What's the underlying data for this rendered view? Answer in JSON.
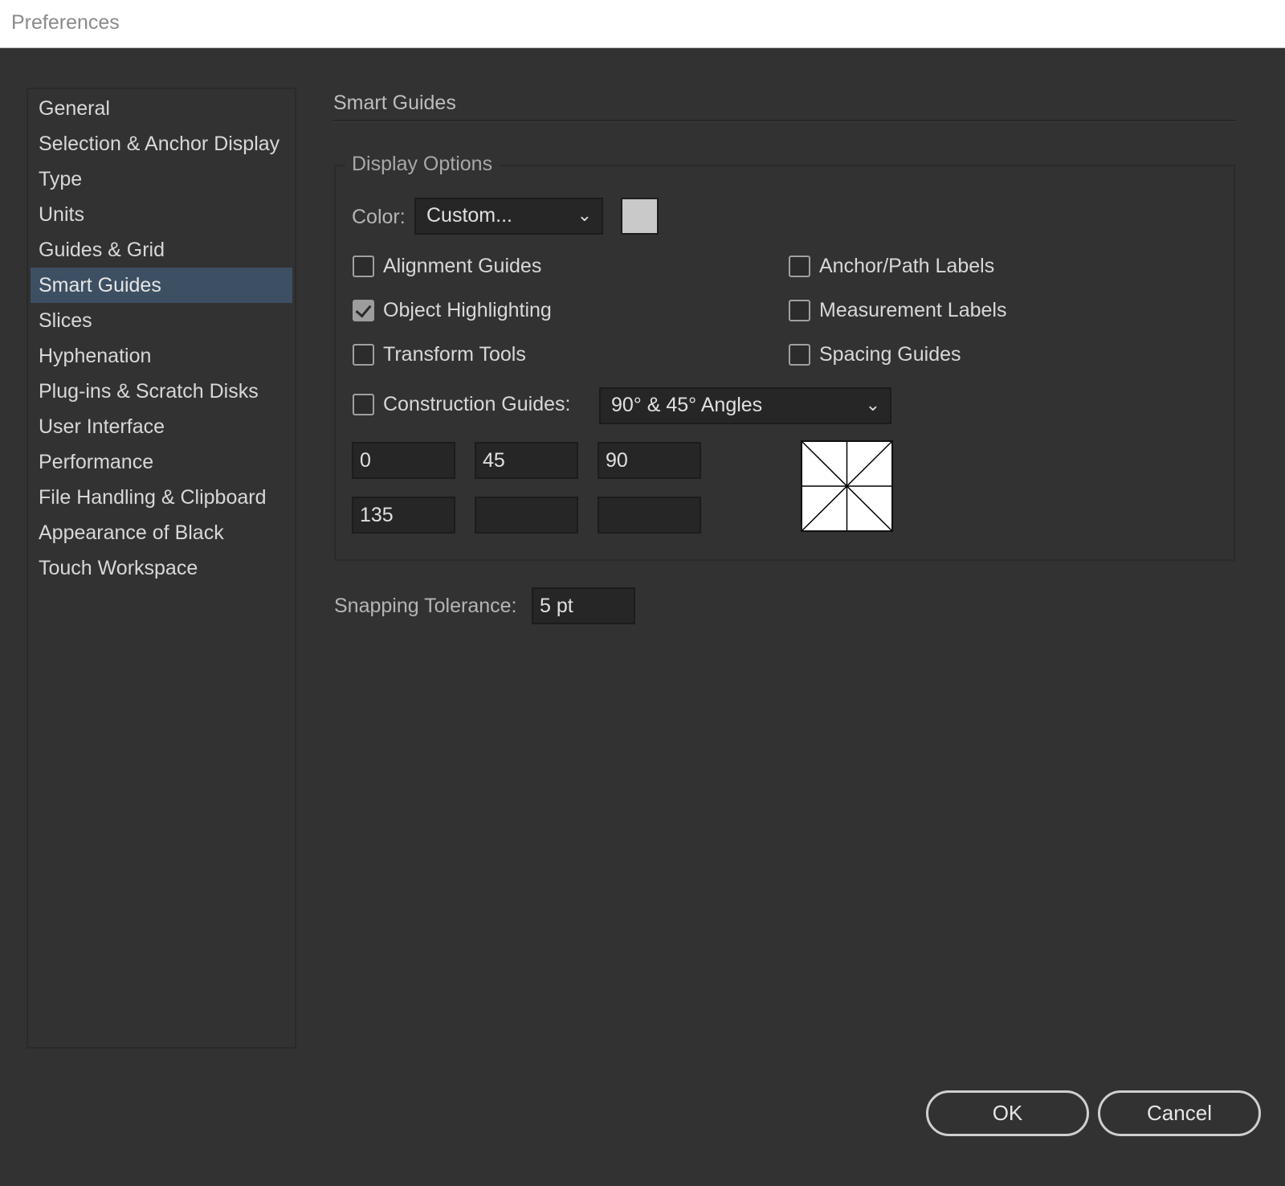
{
  "window": {
    "title": "Preferences"
  },
  "sidebar": {
    "items": [
      {
        "label": "General"
      },
      {
        "label": "Selection & Anchor Display"
      },
      {
        "label": "Type"
      },
      {
        "label": "Units"
      },
      {
        "label": "Guides & Grid"
      },
      {
        "label": "Smart Guides"
      },
      {
        "label": "Slices"
      },
      {
        "label": "Hyphenation"
      },
      {
        "label": "Plug-ins & Scratch Disks"
      },
      {
        "label": "User Interface"
      },
      {
        "label": "Performance"
      },
      {
        "label": "File Handling & Clipboard"
      },
      {
        "label": "Appearance of Black"
      },
      {
        "label": "Touch Workspace"
      }
    ],
    "selected": "Smart Guides"
  },
  "main": {
    "section_title": "Smart Guides",
    "display_options": {
      "group_label": "Display Options",
      "color_label": "Color:",
      "color_value": "Custom...",
      "swatch_color": "#c9c9c9",
      "checkboxes": {
        "alignment_guides": {
          "label": "Alignment Guides",
          "checked": false
        },
        "anchor_path_labels": {
          "label": "Anchor/Path Labels",
          "checked": false
        },
        "object_highlighting": {
          "label": "Object Highlighting",
          "checked": true
        },
        "measurement_labels": {
          "label": "Measurement Labels",
          "checked": false
        },
        "transform_tools": {
          "label": "Transform Tools",
          "checked": false
        },
        "spacing_guides": {
          "label": "Spacing Guides",
          "checked": false
        },
        "construction_guides": {
          "label": "Construction Guides:",
          "checked": false
        }
      },
      "construction_angles_value": "90° & 45° Angles",
      "angles": [
        "0",
        "45",
        "90",
        "135",
        "",
        ""
      ]
    },
    "snapping": {
      "label": "Snapping Tolerance:",
      "value": "5 pt"
    }
  },
  "buttons": {
    "ok": "OK",
    "cancel": "Cancel"
  },
  "colors": {
    "background": "#323232",
    "selection": "#3d4f62",
    "field": "#262626"
  }
}
